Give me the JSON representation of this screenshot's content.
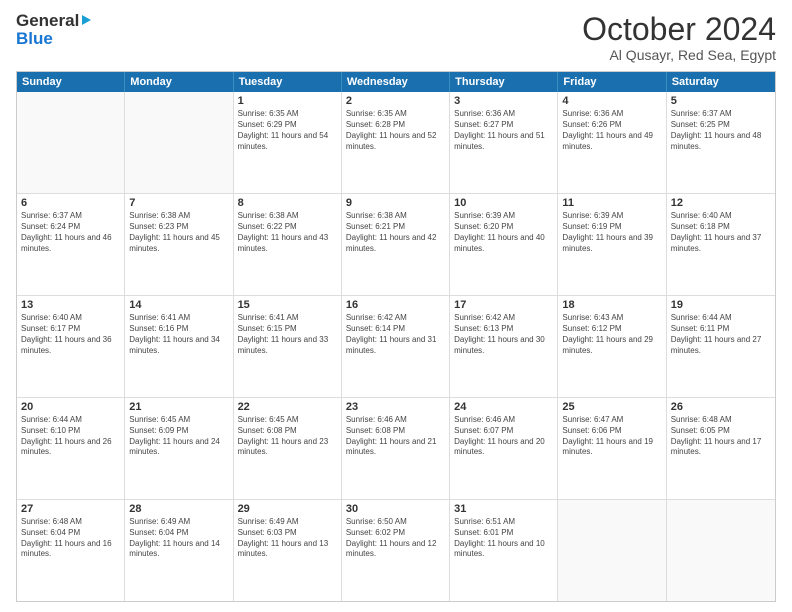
{
  "header": {
    "logo_general": "General",
    "logo_blue": "Blue",
    "month": "October 2024",
    "location": "Al Qusayr, Red Sea, Egypt"
  },
  "calendar": {
    "days": [
      "Sunday",
      "Monday",
      "Tuesday",
      "Wednesday",
      "Thursday",
      "Friday",
      "Saturday"
    ],
    "weeks": [
      [
        {
          "day": "",
          "content": ""
        },
        {
          "day": "",
          "content": ""
        },
        {
          "day": "1",
          "content": "Sunrise: 6:35 AM\nSunset: 6:29 PM\nDaylight: 11 hours and 54 minutes."
        },
        {
          "day": "2",
          "content": "Sunrise: 6:35 AM\nSunset: 6:28 PM\nDaylight: 11 hours and 52 minutes."
        },
        {
          "day": "3",
          "content": "Sunrise: 6:36 AM\nSunset: 6:27 PM\nDaylight: 11 hours and 51 minutes."
        },
        {
          "day": "4",
          "content": "Sunrise: 6:36 AM\nSunset: 6:26 PM\nDaylight: 11 hours and 49 minutes."
        },
        {
          "day": "5",
          "content": "Sunrise: 6:37 AM\nSunset: 6:25 PM\nDaylight: 11 hours and 48 minutes."
        }
      ],
      [
        {
          "day": "6",
          "content": "Sunrise: 6:37 AM\nSunset: 6:24 PM\nDaylight: 11 hours and 46 minutes."
        },
        {
          "day": "7",
          "content": "Sunrise: 6:38 AM\nSunset: 6:23 PM\nDaylight: 11 hours and 45 minutes."
        },
        {
          "day": "8",
          "content": "Sunrise: 6:38 AM\nSunset: 6:22 PM\nDaylight: 11 hours and 43 minutes."
        },
        {
          "day": "9",
          "content": "Sunrise: 6:38 AM\nSunset: 6:21 PM\nDaylight: 11 hours and 42 minutes."
        },
        {
          "day": "10",
          "content": "Sunrise: 6:39 AM\nSunset: 6:20 PM\nDaylight: 11 hours and 40 minutes."
        },
        {
          "day": "11",
          "content": "Sunrise: 6:39 AM\nSunset: 6:19 PM\nDaylight: 11 hours and 39 minutes."
        },
        {
          "day": "12",
          "content": "Sunrise: 6:40 AM\nSunset: 6:18 PM\nDaylight: 11 hours and 37 minutes."
        }
      ],
      [
        {
          "day": "13",
          "content": "Sunrise: 6:40 AM\nSunset: 6:17 PM\nDaylight: 11 hours and 36 minutes."
        },
        {
          "day": "14",
          "content": "Sunrise: 6:41 AM\nSunset: 6:16 PM\nDaylight: 11 hours and 34 minutes."
        },
        {
          "day": "15",
          "content": "Sunrise: 6:41 AM\nSunset: 6:15 PM\nDaylight: 11 hours and 33 minutes."
        },
        {
          "day": "16",
          "content": "Sunrise: 6:42 AM\nSunset: 6:14 PM\nDaylight: 11 hours and 31 minutes."
        },
        {
          "day": "17",
          "content": "Sunrise: 6:42 AM\nSunset: 6:13 PM\nDaylight: 11 hours and 30 minutes."
        },
        {
          "day": "18",
          "content": "Sunrise: 6:43 AM\nSunset: 6:12 PM\nDaylight: 11 hours and 29 minutes."
        },
        {
          "day": "19",
          "content": "Sunrise: 6:44 AM\nSunset: 6:11 PM\nDaylight: 11 hours and 27 minutes."
        }
      ],
      [
        {
          "day": "20",
          "content": "Sunrise: 6:44 AM\nSunset: 6:10 PM\nDaylight: 11 hours and 26 minutes."
        },
        {
          "day": "21",
          "content": "Sunrise: 6:45 AM\nSunset: 6:09 PM\nDaylight: 11 hours and 24 minutes."
        },
        {
          "day": "22",
          "content": "Sunrise: 6:45 AM\nSunset: 6:08 PM\nDaylight: 11 hours and 23 minutes."
        },
        {
          "day": "23",
          "content": "Sunrise: 6:46 AM\nSunset: 6:08 PM\nDaylight: 11 hours and 21 minutes."
        },
        {
          "day": "24",
          "content": "Sunrise: 6:46 AM\nSunset: 6:07 PM\nDaylight: 11 hours and 20 minutes."
        },
        {
          "day": "25",
          "content": "Sunrise: 6:47 AM\nSunset: 6:06 PM\nDaylight: 11 hours and 19 minutes."
        },
        {
          "day": "26",
          "content": "Sunrise: 6:48 AM\nSunset: 6:05 PM\nDaylight: 11 hours and 17 minutes."
        }
      ],
      [
        {
          "day": "27",
          "content": "Sunrise: 6:48 AM\nSunset: 6:04 PM\nDaylight: 11 hours and 16 minutes."
        },
        {
          "day": "28",
          "content": "Sunrise: 6:49 AM\nSunset: 6:04 PM\nDaylight: 11 hours and 14 minutes."
        },
        {
          "day": "29",
          "content": "Sunrise: 6:49 AM\nSunset: 6:03 PM\nDaylight: 11 hours and 13 minutes."
        },
        {
          "day": "30",
          "content": "Sunrise: 6:50 AM\nSunset: 6:02 PM\nDaylight: 11 hours and 12 minutes."
        },
        {
          "day": "31",
          "content": "Sunrise: 6:51 AM\nSunset: 6:01 PM\nDaylight: 11 hours and 10 minutes."
        },
        {
          "day": "",
          "content": ""
        },
        {
          "day": "",
          "content": ""
        }
      ]
    ]
  }
}
